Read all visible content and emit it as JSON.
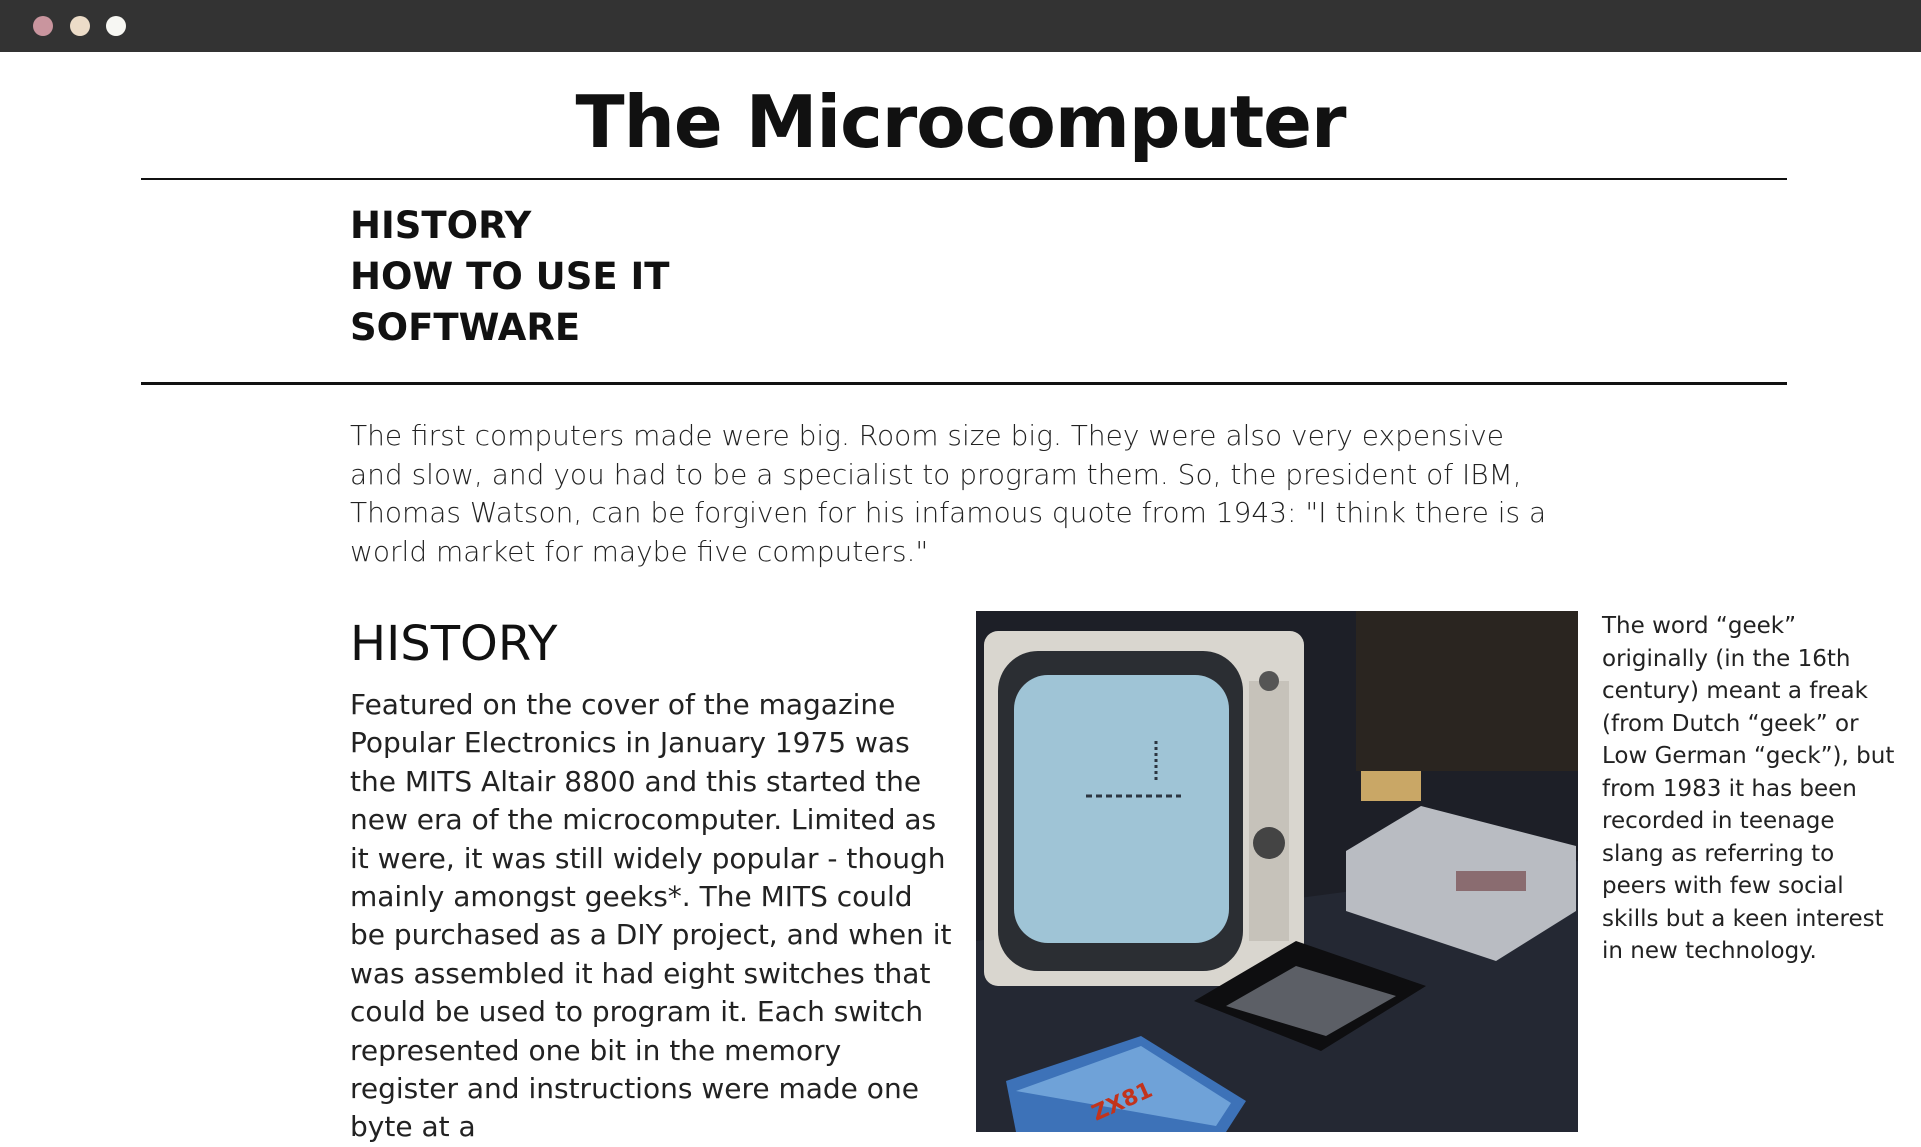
{
  "window": {
    "controls": [
      "close",
      "minimize",
      "maximize"
    ]
  },
  "page": {
    "title": "The Microcomputer"
  },
  "nav": {
    "items": [
      {
        "label": "HISTORY"
      },
      {
        "label": "HOW TO USE IT"
      },
      {
        "label": "SOFTWARE"
      }
    ]
  },
  "intro": "The first computers made were big. Room size big. They were also very expensive and slow, and you had to be a specialist to program them. So, the president of IBM, Thomas Watson, can be forgiven for his infamous quote from 1943: \"I think there is a world market for maybe five computers.\"",
  "history": {
    "heading": "HISTORY",
    "body": "Featured on the cover of the magazine Popular Electronics in January 1975 was the MITS Altair 8800 and this started the new era of the microcomputer. Limited as it were, it was still widely popular - though mainly amongst geeks*. The MITS could be purchased as a DIY project, and when it was assembled it had eight switches that could be used to program it. Each switch represented one bit in the memory register and instructions were made one byte at a"
  },
  "sidenote": "The word “geek” originally (in the 16th century) meant a freak (from Dutch “geek” or Low German “geck”), but from 1983 it has been recorded in teenage slang as referring to peers with few social skills but a keen interest in new technology.",
  "photo": {
    "subject": "vintage-computer-setup",
    "manual_cover_text": "ZX81"
  },
  "colors": {
    "titlebar": "#333333",
    "dot_close": "#c9959e",
    "dot_minimize": "#ecdcc8",
    "dot_maximize": "#f7f7f3"
  }
}
